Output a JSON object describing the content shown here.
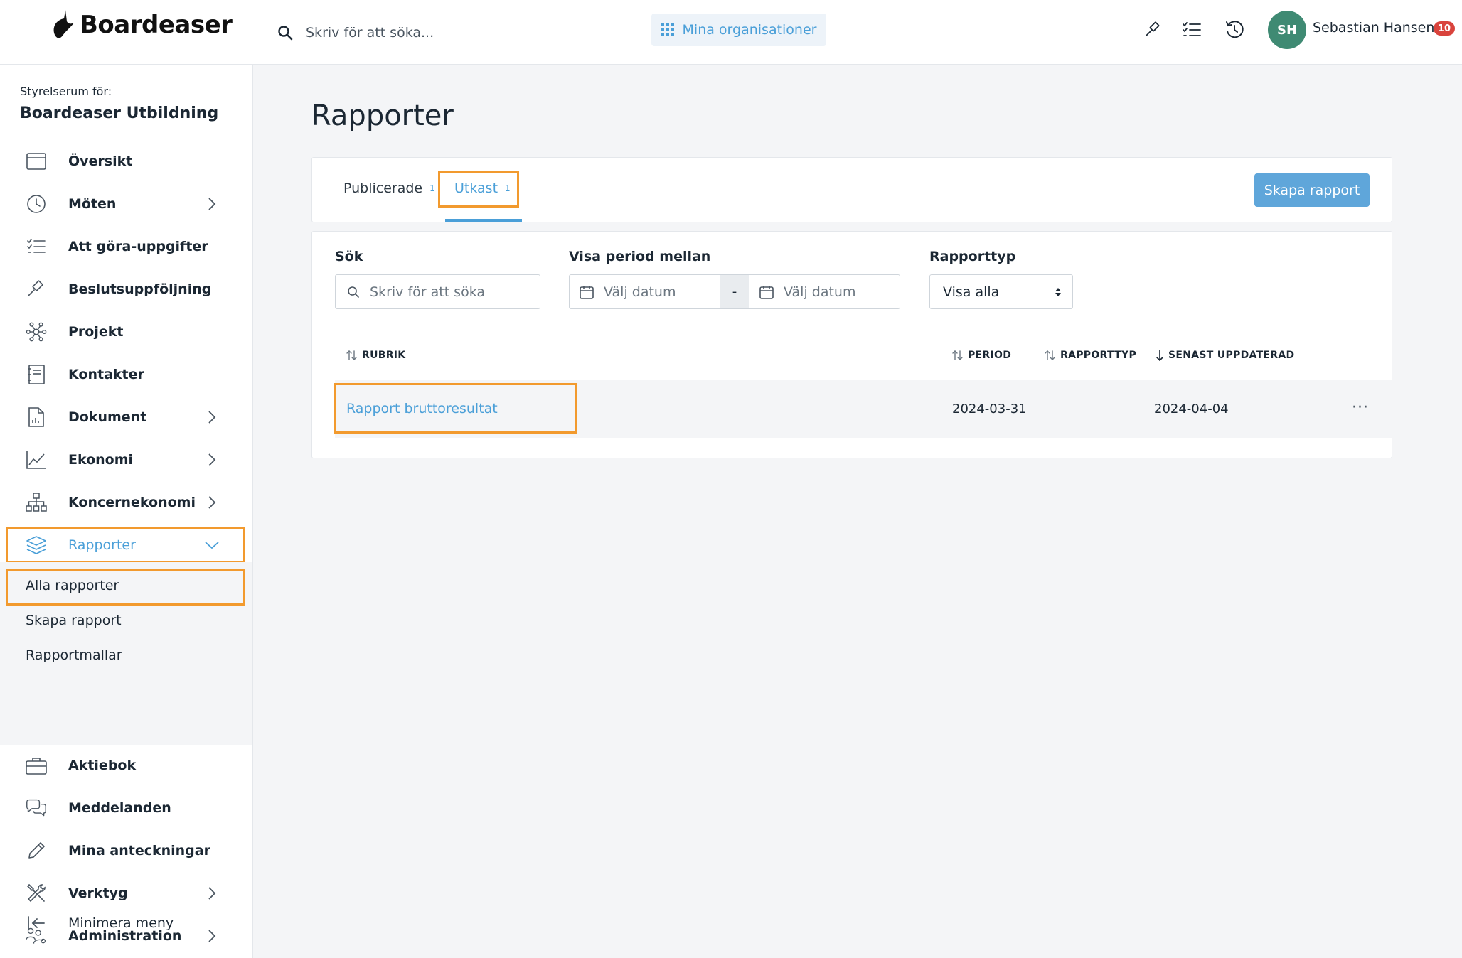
{
  "header": {
    "brand": "Boardeaser",
    "search_placeholder": "Skriv för att söka...",
    "orgs_label": "Mina organisationer",
    "user": {
      "initials": "SH",
      "name": "Sebastian Hansen",
      "notifications": "10",
      "avatar_color": "#3f8a73"
    },
    "icons": [
      "gavel-icon",
      "checklist-icon",
      "history-icon"
    ]
  },
  "sidebar": {
    "caption": "Styrelserum för:",
    "board_name": "Boardeaser Utbildning",
    "items": [
      {
        "label": "Översikt",
        "icon": "calendar-icon",
        "chevron": false
      },
      {
        "label": "Möten",
        "icon": "clock-icon",
        "chevron": true
      },
      {
        "label": "Att göra-uppgifter",
        "icon": "checklist-icon",
        "chevron": false
      },
      {
        "label": "Beslutsuppföljning",
        "icon": "gavel-icon",
        "chevron": false
      },
      {
        "label": "Projekt",
        "icon": "network-icon",
        "chevron": false
      },
      {
        "label": "Kontakter",
        "icon": "address-book-icon",
        "chevron": false
      },
      {
        "label": "Dokument",
        "icon": "document-icon",
        "chevron": true
      },
      {
        "label": "Ekonomi",
        "icon": "line-chart-icon",
        "chevron": true
      },
      {
        "label": "Koncernekonomi",
        "icon": "org-chart-icon",
        "chevron": true
      },
      {
        "label": "Rapporter",
        "icon": "layers-icon",
        "chevron": "down",
        "active": true
      },
      {
        "label": "Aktiebok",
        "icon": "briefcase-icon",
        "chevron": false
      },
      {
        "label": "Meddelanden",
        "icon": "chat-icon",
        "chevron": false
      },
      {
        "label": "Mina anteckningar",
        "icon": "pencil-icon",
        "chevron": false
      },
      {
        "label": "Verktyg",
        "icon": "tools-icon",
        "chevron": true
      },
      {
        "label": "Administration",
        "icon": "users-gear-icon",
        "chevron": true
      }
    ],
    "sub_items": [
      "Alla rapporter",
      "Skapa rapport",
      "Rapportmallar"
    ],
    "minimize_label": "Minimera meny"
  },
  "main": {
    "title": "Rapporter",
    "tabs": [
      {
        "label": "Publicerade",
        "count": "1"
      },
      {
        "label": "Utkast",
        "count": "1",
        "active": true
      }
    ],
    "create_button": "Skapa rapport",
    "filters": {
      "search_label": "Sök",
      "search_placeholder": "Skriv för att söka",
      "period_label": "Visa period mellan",
      "date_from_placeholder": "Välj datum",
      "date_separator": "-",
      "date_to_placeholder": "Välj datum",
      "type_label": "Rapporttyp",
      "type_value": "Visa alla"
    },
    "table": {
      "columns": [
        "RUBRIK",
        "PERIOD",
        "RAPPORTTYP",
        "SENAST UPPDATERAD"
      ],
      "rows": [
        {
          "title": "Rapport bruttoresultat",
          "period": "2024-03-31",
          "type": "",
          "updated": "2024-04-04",
          "actions": "···"
        }
      ]
    }
  },
  "colors": {
    "accent": "#4a9fd8",
    "highlight": "#f29a2e",
    "badge": "#d9433c"
  }
}
